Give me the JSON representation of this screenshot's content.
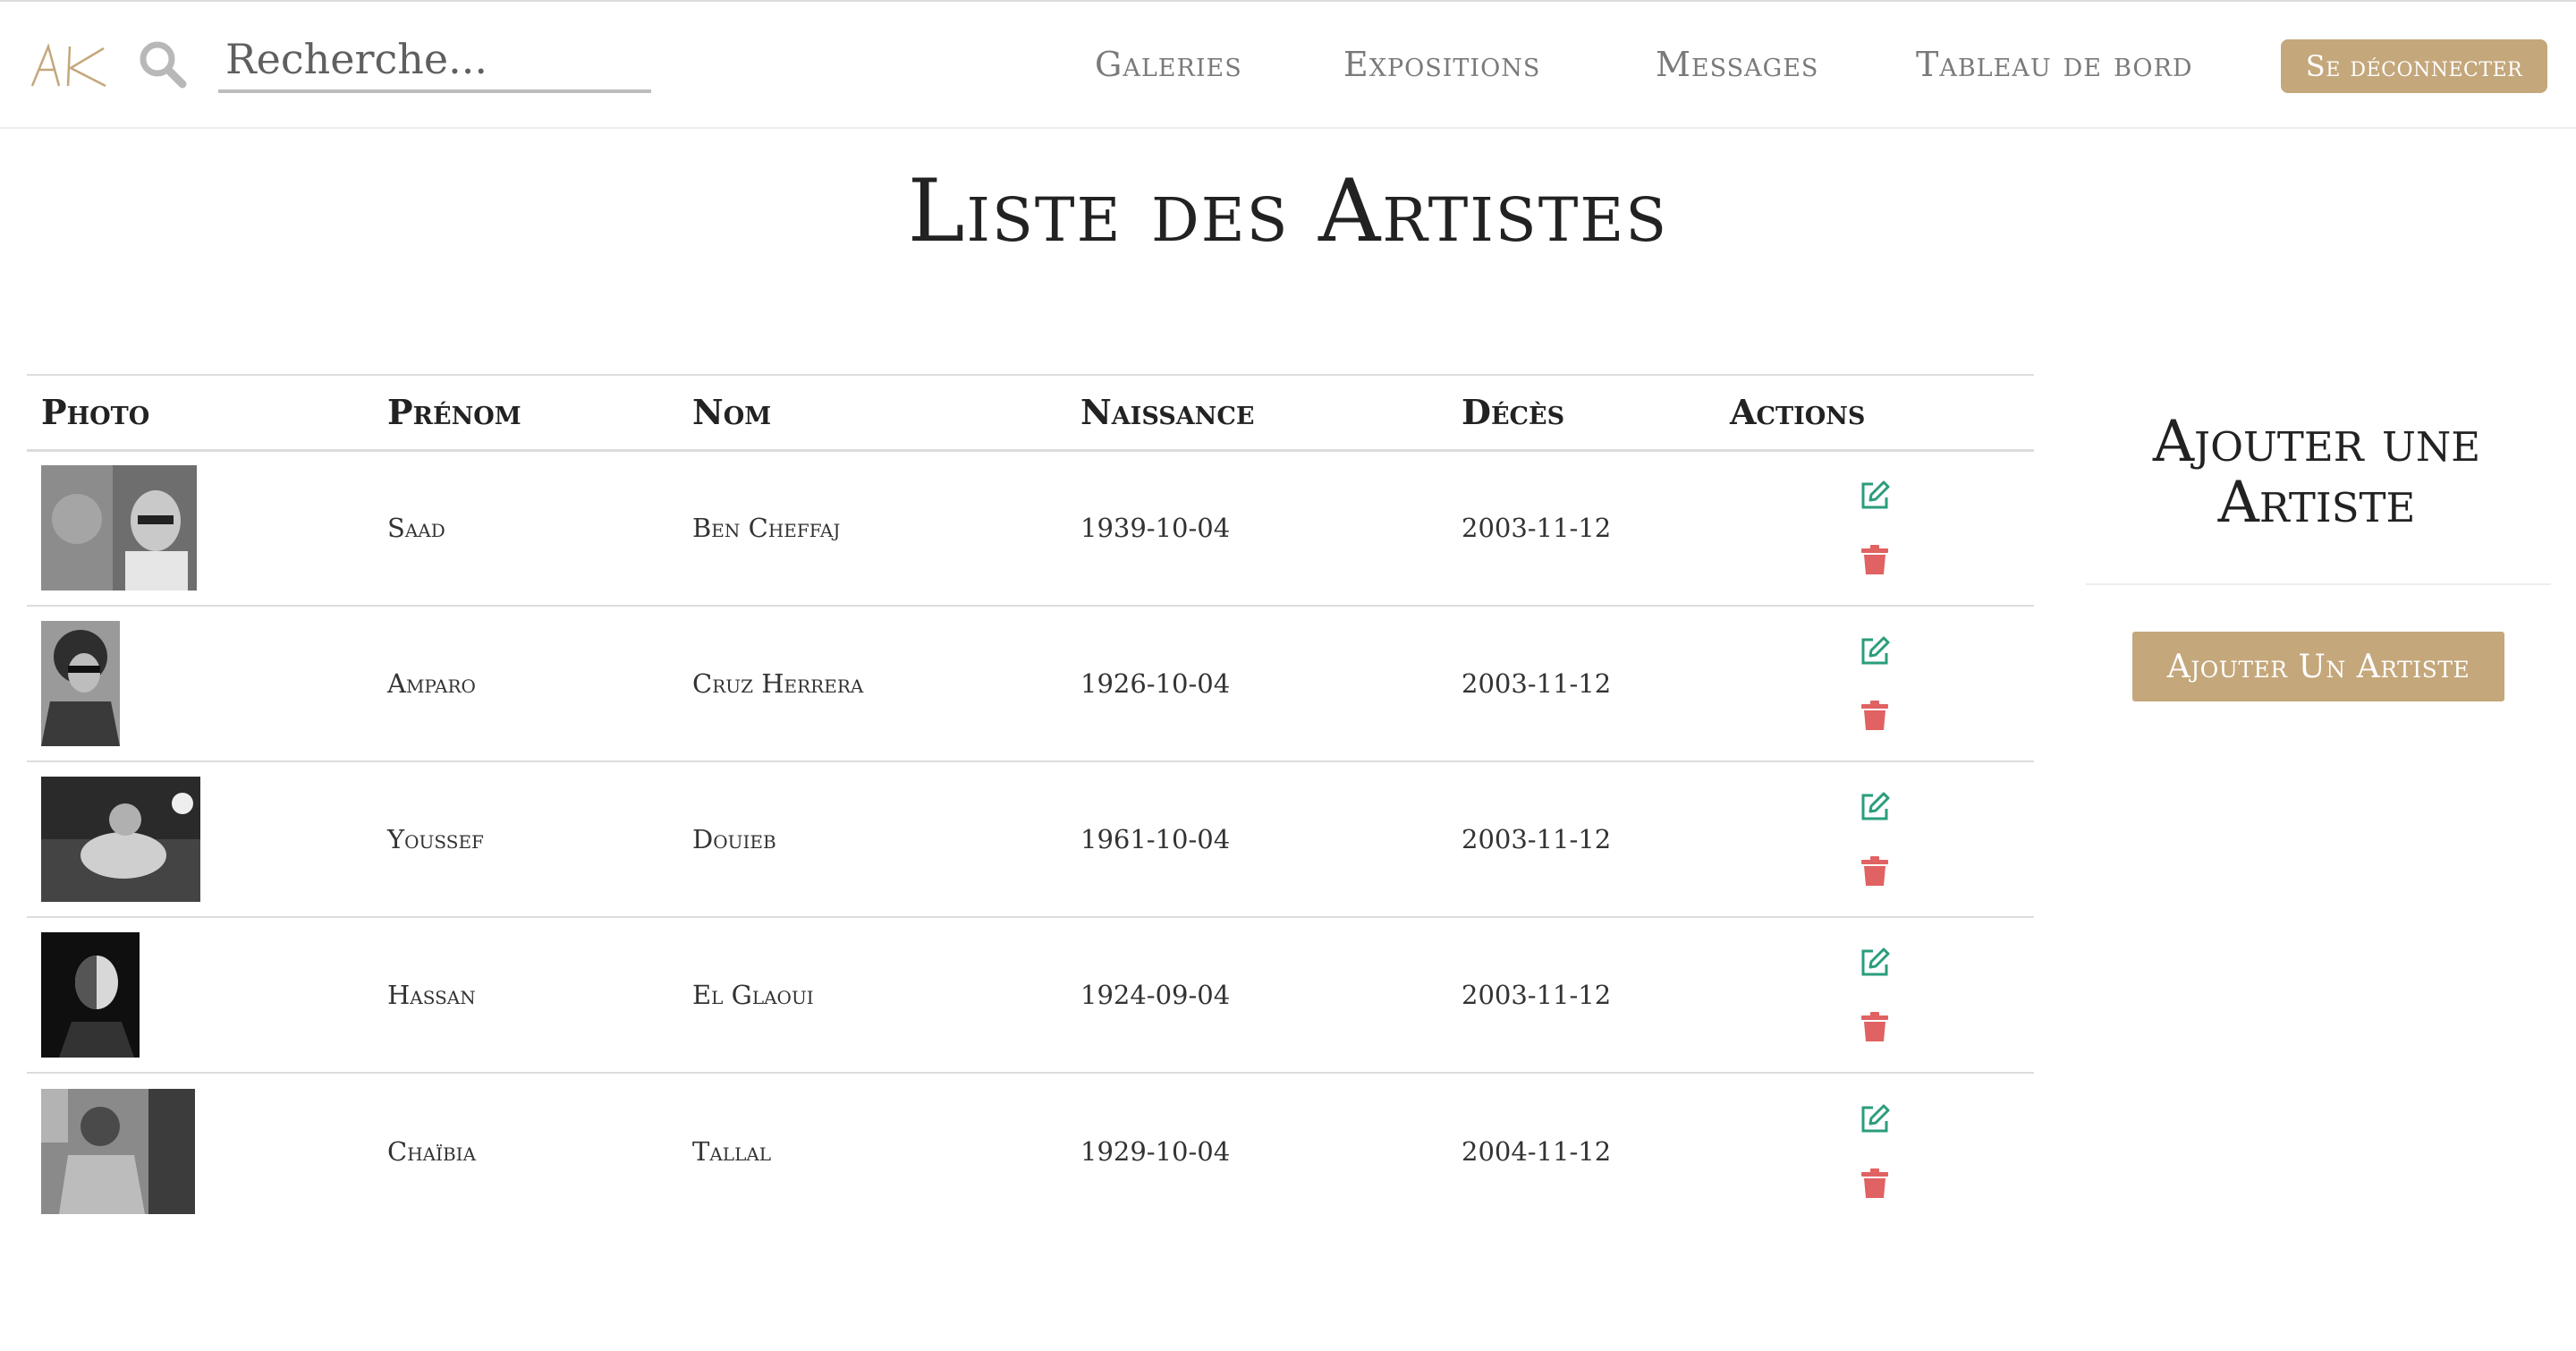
{
  "colors": {
    "accent": "#c4a77b",
    "edit": "#2a9d7c",
    "delete": "#e06262"
  },
  "header": {
    "logo_text": "AK",
    "search": {
      "placeholder": "Recherche...",
      "value": ""
    },
    "nav": [
      "Galeries",
      "Expositions",
      "Messages",
      "Tableau de bord"
    ],
    "logout_label": "Se déconnecter"
  },
  "page_title": "Liste des Artistes",
  "table": {
    "columns": [
      "Photo",
      "Prénom",
      "Nom",
      "Naissance",
      "Décès",
      "Actions"
    ],
    "rows": [
      {
        "prenom": "Saad",
        "nom": "Ben Cheffaj",
        "naissance": "1939-10-04",
        "deces": "2003-11-12"
      },
      {
        "prenom": "Amparo",
        "nom": "Cruz Herrera",
        "naissance": "1926-10-04",
        "deces": "2003-11-12"
      },
      {
        "prenom": "Youssef",
        "nom": "Douieb",
        "naissance": "1961-10-04",
        "deces": "2003-11-12"
      },
      {
        "prenom": "Hassan",
        "nom": "El Glaoui",
        "naissance": "1924-09-04",
        "deces": "2003-11-12"
      },
      {
        "prenom": "Chaïbia",
        "nom": "Tallal",
        "naissance": "1929-10-04",
        "deces": "2004-11-12"
      }
    ],
    "row_icons": {
      "edit": "edit-icon",
      "delete": "trash-icon"
    }
  },
  "sidebar": {
    "title": "Ajouter une Artiste",
    "add_button_label": "Ajouter Un Artiste"
  }
}
